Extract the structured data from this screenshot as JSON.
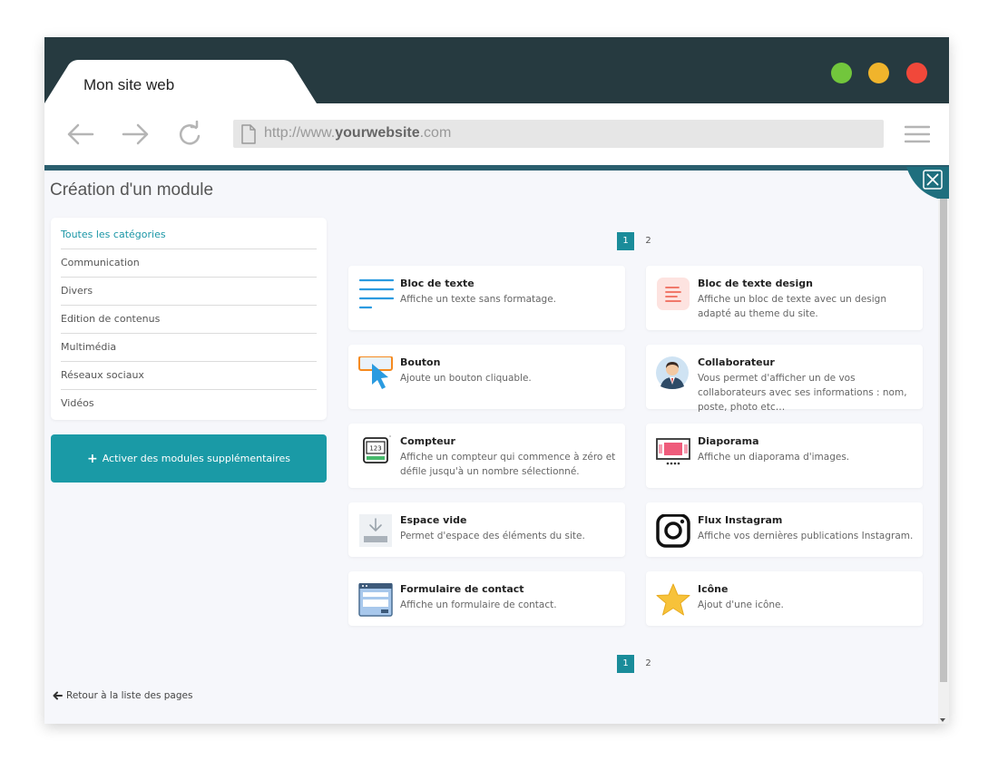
{
  "browser": {
    "tab_title": "Mon site web",
    "url_prefix": "http://www.",
    "url_domain": "yourwebsite",
    "url_suffix": ".com",
    "window_dots": [
      "#72c63c",
      "#f0b42c",
      "#f1483a"
    ]
  },
  "page": {
    "title": "Création d'un module",
    "back_label": "Retour à la liste des pages"
  },
  "categories": [
    {
      "label": "Toutes les catégories",
      "active": true
    },
    {
      "label": "Communication",
      "active": false
    },
    {
      "label": "Divers",
      "active": false
    },
    {
      "label": "Edition de contenus",
      "active": false
    },
    {
      "label": "Multimédia",
      "active": false
    },
    {
      "label": "Réseaux sociaux",
      "active": false
    },
    {
      "label": "Vidéos",
      "active": false
    }
  ],
  "activate_button": "Activer des modules supplémentaires",
  "pagination": {
    "pages": [
      "1",
      "2"
    ],
    "current": "1"
  },
  "modules": [
    {
      "title": "Bloc de texte",
      "description": "Affiche un texte sans formatage.",
      "icon": "text-lines-icon"
    },
    {
      "title": "Bloc de texte design",
      "description": "Affiche un bloc de texte avec un design adapté au theme du site.",
      "icon": "text-design-icon"
    },
    {
      "title": "Bouton",
      "description": "Ajoute un bouton cliquable.",
      "icon": "button-cursor-icon"
    },
    {
      "title": "Collaborateur",
      "description": "Vous permet d'afficher un de vos collaborateurs avec ses informations : nom, poste, photo etc…",
      "icon": "person-avatar-icon"
    },
    {
      "title": "Compteur",
      "description": "Affiche un compteur qui commence à zéro et défile jusqu'à un nombre sélectionné.",
      "icon": "counter-icon"
    },
    {
      "title": "Diaporama",
      "description": "Affiche un diaporama d'images.",
      "icon": "slideshow-icon"
    },
    {
      "title": "Espace vide",
      "description": "Permet d'espace des éléments du site.",
      "icon": "empty-space-icon"
    },
    {
      "title": "Flux Instagram",
      "description": "Affiche vos dernières publications Instagram.",
      "icon": "instagram-icon"
    },
    {
      "title": "Formulaire de contact",
      "description": "Affiche un formulaire de contact.",
      "icon": "contact-form-icon"
    },
    {
      "title": "Icône",
      "description": "Ajout d'une icône.",
      "icon": "star-icon"
    }
  ],
  "colors": {
    "accent": "#1a9aa6",
    "titlebar": "#263a40",
    "accent_line": "#2a5e6e"
  }
}
